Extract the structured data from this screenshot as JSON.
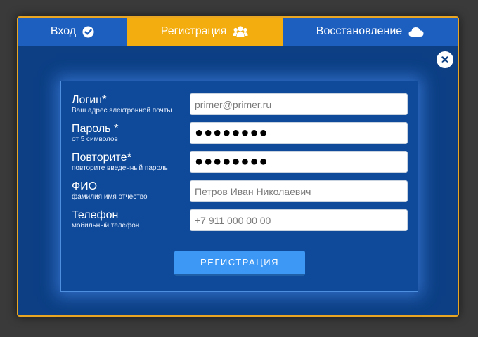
{
  "tabs": [
    {
      "label": "Вход",
      "icon": "check-circle-icon"
    },
    {
      "label": "Регистрация",
      "icon": "users-icon",
      "active": true
    },
    {
      "label": "Восстановление",
      "icon": "cloud-icon"
    }
  ],
  "colors": {
    "background": "#3a3a3a",
    "modal": "#0c3f84",
    "border": "#e8a623",
    "tab": "#1d5fbf",
    "tab_active": "#f3ad0f",
    "button": "#3d98f5"
  },
  "close_icon": "close-icon",
  "form": {
    "fields": [
      {
        "label": "Логин",
        "required_mark": "*",
        "hint": "Ваш адрес электронной почты",
        "placeholder": "primer@primer.ru",
        "value": ""
      },
      {
        "label": "Пароль",
        "required_mark": "*",
        "hint": "от 5 символов",
        "placeholder": "",
        "value": "●●●●●●●●"
      },
      {
        "label": "Повторите",
        "required_mark": "*",
        "hint": "повторите введенный пароль",
        "placeholder": "",
        "value": "●●●●●●●●"
      },
      {
        "label": "ФИО",
        "required_mark": "",
        "hint": "фамилия имя отчество",
        "placeholder": "Петров Иван Николаевич",
        "value": ""
      },
      {
        "label": "Телефон",
        "required_mark": "",
        "hint": "мобильный телефон",
        "placeholder": "+7 911 000 00 00",
        "value": ""
      }
    ],
    "submit_label": "РЕГИСТРАЦИЯ"
  }
}
